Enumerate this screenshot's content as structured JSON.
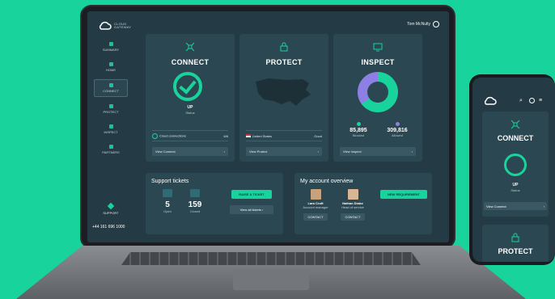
{
  "brand": {
    "name": "CLOUD GATEWAY"
  },
  "user": {
    "name": "Tom McNulty",
    "icon": "user-icon"
  },
  "sidebar": {
    "items": [
      {
        "label": "SUMMARY",
        "icon": "summary-icon"
      },
      {
        "label": "HOME",
        "icon": "home-icon"
      },
      {
        "label": "CONNECT",
        "icon": "connect-icon"
      },
      {
        "label": "PROTECT",
        "icon": "protect-icon"
      },
      {
        "label": "INSPECT",
        "icon": "inspect-icon"
      },
      {
        "label": "PARTNERS",
        "icon": "partners-icon"
      }
    ],
    "support": "SUPPORT",
    "phone": "+44 161 696 1000"
  },
  "connect": {
    "title": "CONNECT",
    "status": "UP",
    "status_label": "Status",
    "metric_label": "Cloud connections",
    "metric_value": "6/6",
    "button": "View Connect"
  },
  "protect": {
    "title": "PROTECT",
    "country": "United States",
    "country_value": "Good",
    "button": "View Protect"
  },
  "inspect": {
    "title": "INSPECT",
    "blocked_value": "85,895",
    "blocked_label": "Blocked",
    "allowed_value": "309,816",
    "allowed_label": "Allowed",
    "button": "View Inspect",
    "blocked_color": "#19d39c",
    "allowed_color": "#8d7fe3",
    "blocked_fraction": 0.65
  },
  "support_tickets": {
    "title": "Support tickets",
    "open_value": "5",
    "open_label": "Open",
    "closed_value": "159",
    "closed_label": "Closed",
    "raise_button": "RAISE A TICKET",
    "view_all": "View all tickets"
  },
  "account": {
    "title": "My account overview",
    "people": [
      {
        "name": "Lara Croft",
        "role": "Account manager",
        "button": "CONTACT"
      },
      {
        "name": "Nathan Drake",
        "role": "Head of service",
        "button": "CONTACT"
      }
    ],
    "new_requirement": "NEW REQUIREMENT"
  },
  "phone": {
    "connect_title": "CONNECT",
    "status": "UP",
    "status_label": "Status",
    "button": "View Connect",
    "protect_title": "PROTECT"
  },
  "colors": {
    "accent": "#19d39c",
    "panel": "#2b4752",
    "background": "#243b45"
  }
}
